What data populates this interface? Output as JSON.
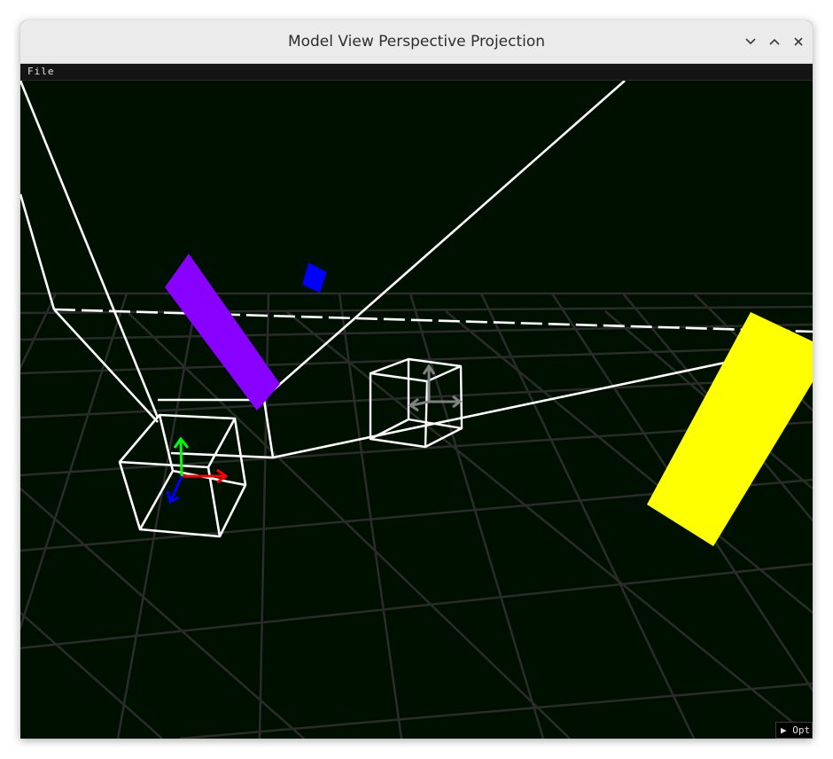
{
  "window": {
    "title": "Model View Perspective Projection",
    "controls": [
      "minimize",
      "maximize",
      "close"
    ]
  },
  "menubar": {
    "items": [
      {
        "label": "File"
      }
    ]
  },
  "viewport": {
    "background_color": "#001000",
    "grid_color": "#2b2b2b",
    "wireframe_color": "#ffffff",
    "objects": [
      {
        "name": "purple-slab",
        "color": "#8800ff"
      },
      {
        "name": "blue-square",
        "color": "#0000ff"
      },
      {
        "name": "yellow-slab",
        "color": "#ffff00"
      },
      {
        "name": "selected-wire-cube",
        "gizmo": "translate",
        "axis_colors": {
          "x": "#ff0000",
          "y": "#00ff00",
          "z": "#0000ff"
        }
      },
      {
        "name": "distant-wire-cube",
        "gizmo": "translate-inactive",
        "gizmo_color": "#808080"
      }
    ]
  },
  "options_toggle": {
    "arrow": "▶",
    "label": "Options",
    "visible_text": "Opt"
  }
}
